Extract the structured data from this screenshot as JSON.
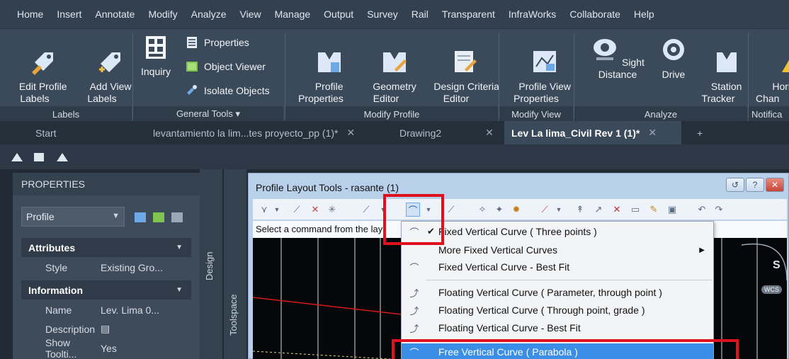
{
  "ribbon_tabs": [
    "Home",
    "Insert",
    "Annotate",
    "Modify",
    "Analyze",
    "View",
    "Manage",
    "Output",
    "Survey",
    "Rail",
    "Transparent",
    "InfraWorks",
    "Collaborate",
    "Help"
  ],
  "groups": {
    "labels": {
      "footer": "Labels",
      "edit_profile_labels": "Edit Profile\nLabels",
      "add_view_labels": "Add View\nLabels"
    },
    "general_tools": {
      "footer": "General Tools ▾",
      "inquiry": "Inquiry",
      "properties": "Properties",
      "object_viewer": "Object Viewer",
      "isolate_objects": "Isolate Objects"
    },
    "modify_profile": {
      "footer": "Modify Profile",
      "profile_properties": "Profile\nProperties",
      "geometry_editor": "Geometry\nEditor",
      "design_criteria_editor": "Design Criteria\nEditor"
    },
    "modify_view": {
      "footer": "Modify View",
      "profile_view_properties": "Profile View\nProperties"
    },
    "analyze": {
      "footer": "Analyze",
      "sight_distance": "Sight Distance",
      "drive": "Drive",
      "station_tracker": "Station\nTracker"
    },
    "notifications": {
      "footer": "Notifica",
      "horizon_change": "Horizo\nChan"
    }
  },
  "doc_tabs": {
    "start": "Start",
    "tab1": "levantamiento la lim...tes proyecto_pp (1)*",
    "tab2": "Drawing2",
    "tab3": "Lev La lima_Civil Rev 1 (1)*",
    "close": "✕",
    "plus": "+"
  },
  "properties_panel": {
    "title": "PROPERTIES",
    "selector": "Profile",
    "attributes_header": "Attributes",
    "style_key": "Style",
    "style_value": "Existing Gro...",
    "information_header": "Information",
    "name_key": "Name",
    "name_value": "Lev. Lima 0...",
    "description_key": "Description",
    "show_tooltip_key": "Show Toolti...",
    "show_tooltip_value": "Yes"
  },
  "side_labels": {
    "design": "Design",
    "toolspace": "Toolspace"
  },
  "profile_layout_tools": {
    "title": "Profile Layout Tools - rasante (1)",
    "status": "Select a command from the lay"
  },
  "menu_items": [
    {
      "label": "Fixed Vertical Curve ( Three points )",
      "checked": true
    },
    {
      "label": "More Fixed Vertical Curves",
      "submenu": true
    },
    {
      "label": "Fixed Vertical Curve - Best Fit"
    },
    {
      "label": "Floating Vertical Curve ( Parameter, through point )"
    },
    {
      "label": "Floating Vertical Curve ( Through point, grade )"
    },
    {
      "label": "Floating Vertical Curve - Best Fit"
    },
    {
      "label": "Free Vertical Curve ( Parabola )",
      "selected": true
    }
  ],
  "canvas_labels": {
    "s": "S",
    "wcs": "WCS"
  },
  "colors": {
    "highlight": "#e0101c",
    "selection": "#3a8ee6",
    "ribbon": "#3b4a5a"
  }
}
